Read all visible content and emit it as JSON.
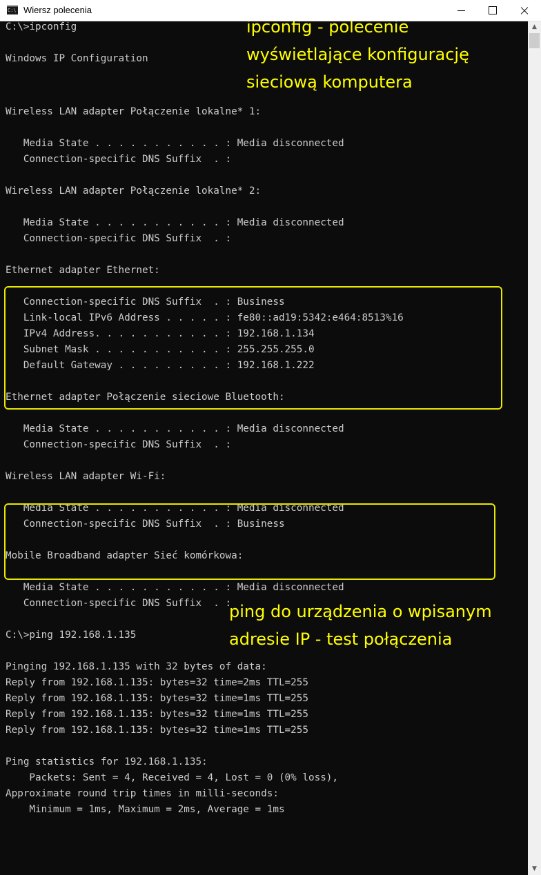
{
  "window": {
    "title": "Wiersz polecenia",
    "icon": "cmd-icon",
    "icon_text": "C:\\"
  },
  "console": {
    "lines": [
      "C:\\>ipconfig",
      "Windows IP Configuration",
      "Wireless LAN adapter Połączenie lokalne* 1:",
      "   Media State . . . . . . . . . . . : Media disconnected",
      "   Connection-specific DNS Suffix  . :",
      "Wireless LAN adapter Połączenie lokalne* 2:",
      "   Media State . . . . . . . . . . . : Media disconnected",
      "   Connection-specific DNS Suffix  . :",
      "Ethernet adapter Ethernet:",
      "   Connection-specific DNS Suffix  . : Business",
      "   Link-local IPv6 Address . . . . . : fe80::ad19:5342:e464:8513%16",
      "   IPv4 Address. . . . . . . . . . . : 192.168.1.134",
      "   Subnet Mask . . . . . . . . . . . : 255.255.255.0",
      "   Default Gateway . . . . . . . . . : 192.168.1.222",
      "Ethernet adapter Połączenie sieciowe Bluetooth:",
      "   Media State . . . . . . . . . . . : Media disconnected",
      "   Connection-specific DNS Suffix  . :",
      "Wireless LAN adapter Wi-Fi:",
      "   Media State . . . . . . . . . . . : Media disconnected",
      "   Connection-specific DNS Suffix  . : Business",
      "Mobile Broadband adapter Sieć komórkowa:",
      "   Media State . . . . . . . . . . . : Media disconnected",
      "   Connection-specific DNS Suffix  . :",
      "C:\\>ping 192.168.1.135",
      "Pinging 192.168.1.135 with 32 bytes of data:",
      "Reply from 192.168.1.135: bytes=32 time=2ms TTL=255",
      "Reply from 192.168.1.135: bytes=32 time=1ms TTL=255",
      "Reply from 192.168.1.135: bytes=32 time=1ms TTL=255",
      "Reply from 192.168.1.135: bytes=32 time=1ms TTL=255",
      "Ping statistics for 192.168.1.135:",
      "    Packets: Sent = 4, Received = 4, Lost = 0 (0% loss),",
      "Approximate round trip times in milli-seconds:",
      "    Minimum = 1ms, Maximum = 2ms, Average = 1ms"
    ]
  },
  "annotations": {
    "ipconfig": [
      "ipconfig - polecenie",
      "wyświetlające konfigurację",
      "sieciową komputera"
    ],
    "ping": [
      "ping do urządzenia o wpisanym",
      "adresie IP - test połączenia"
    ]
  },
  "colors": {
    "console_background": "#0c0c0c",
    "console_text": "#cccccc",
    "annotation_text": "#ffff00",
    "highlight_border": "#e8e800"
  }
}
